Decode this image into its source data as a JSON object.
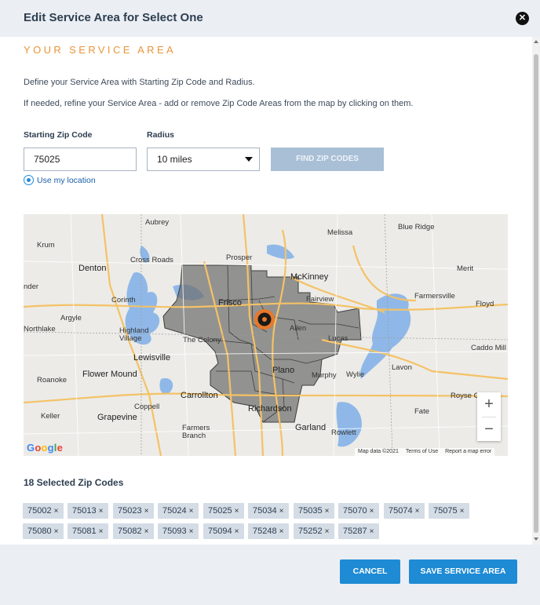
{
  "dialog": {
    "title": "Edit Service Area for Select One",
    "close_icon": "close-icon"
  },
  "section": {
    "heading": "YOUR SERVICE AREA",
    "description_1": "Define your Service Area with Starting Zip Code and Radius.",
    "description_2": "If needed, refine your Service Area - add or remove Zip Code Areas from the map by clicking on them."
  },
  "form": {
    "zip_label": "Starting Zip Code",
    "zip_value": "75025",
    "radius_label": "Radius",
    "radius_value": "10 miles",
    "find_button": "FIND ZIP CODES",
    "use_location": "Use my location"
  },
  "map": {
    "labels": {
      "aubrey": "Aubrey",
      "melissa": "Melissa",
      "blue_ridge": "Blue Ridge",
      "krum": "Krum",
      "cross_roads": "Cross Roads",
      "prosper": "Prosper",
      "mckinney": "McKinney",
      "denton": "Denton",
      "merit": "Merit",
      "corinth": "Corinth",
      "frisco": "Frisco",
      "fairview": "Fairview",
      "farmersville": "Farmersville",
      "floyd": "Floyd",
      "argyle": "Argyle",
      "northlake": "Northlake",
      "highland_village": "Highland\nVillage",
      "allen": "Allen",
      "lucas": "Lucas",
      "the_colony": "The Colony",
      "caddo_mill": "Caddo Mill",
      "lewisville": "Lewisville",
      "plano": "Plano",
      "lavon": "Lavon",
      "roanoke": "Roanoke",
      "flower_mound": "Flower Mound",
      "murphy": "Murphy",
      "wylie": "Wylie",
      "carrollton": "Carrollton",
      "royse_city": "Royse City",
      "keller": "Keller",
      "coppell": "Coppell",
      "grapevine": "Grapevine",
      "richardson": "Richardson",
      "fate": "Fate",
      "farmers_branch": "Farmers\nBranch",
      "garland": "Garland",
      "rowlett": "Rowlett",
      "nder": "nder"
    },
    "zoom_in": "+",
    "zoom_out": "−",
    "google": "Google",
    "map_data": "Map data ©2021",
    "terms": "Terms of Use",
    "report": "Report a map error",
    "pin_icon": "gear-pin-icon"
  },
  "selected": {
    "title": "18 Selected Zip Codes",
    "zips": [
      "75002",
      "75013",
      "75023",
      "75024",
      "75025",
      "75034",
      "75035",
      "75070",
      "75074",
      "75075",
      "75080",
      "75081",
      "75082",
      "75093",
      "75094",
      "75248",
      "75252",
      "75287"
    ],
    "remove_icon": "×"
  },
  "footer": {
    "cancel": "CANCEL",
    "save": "SAVE SERVICE AREA"
  },
  "colors": {
    "accent_orange": "#e8953a",
    "primary_blue": "#1f8bd4",
    "disabled_blue": "#a9bfd6",
    "chip_bg": "#d4dce6"
  }
}
